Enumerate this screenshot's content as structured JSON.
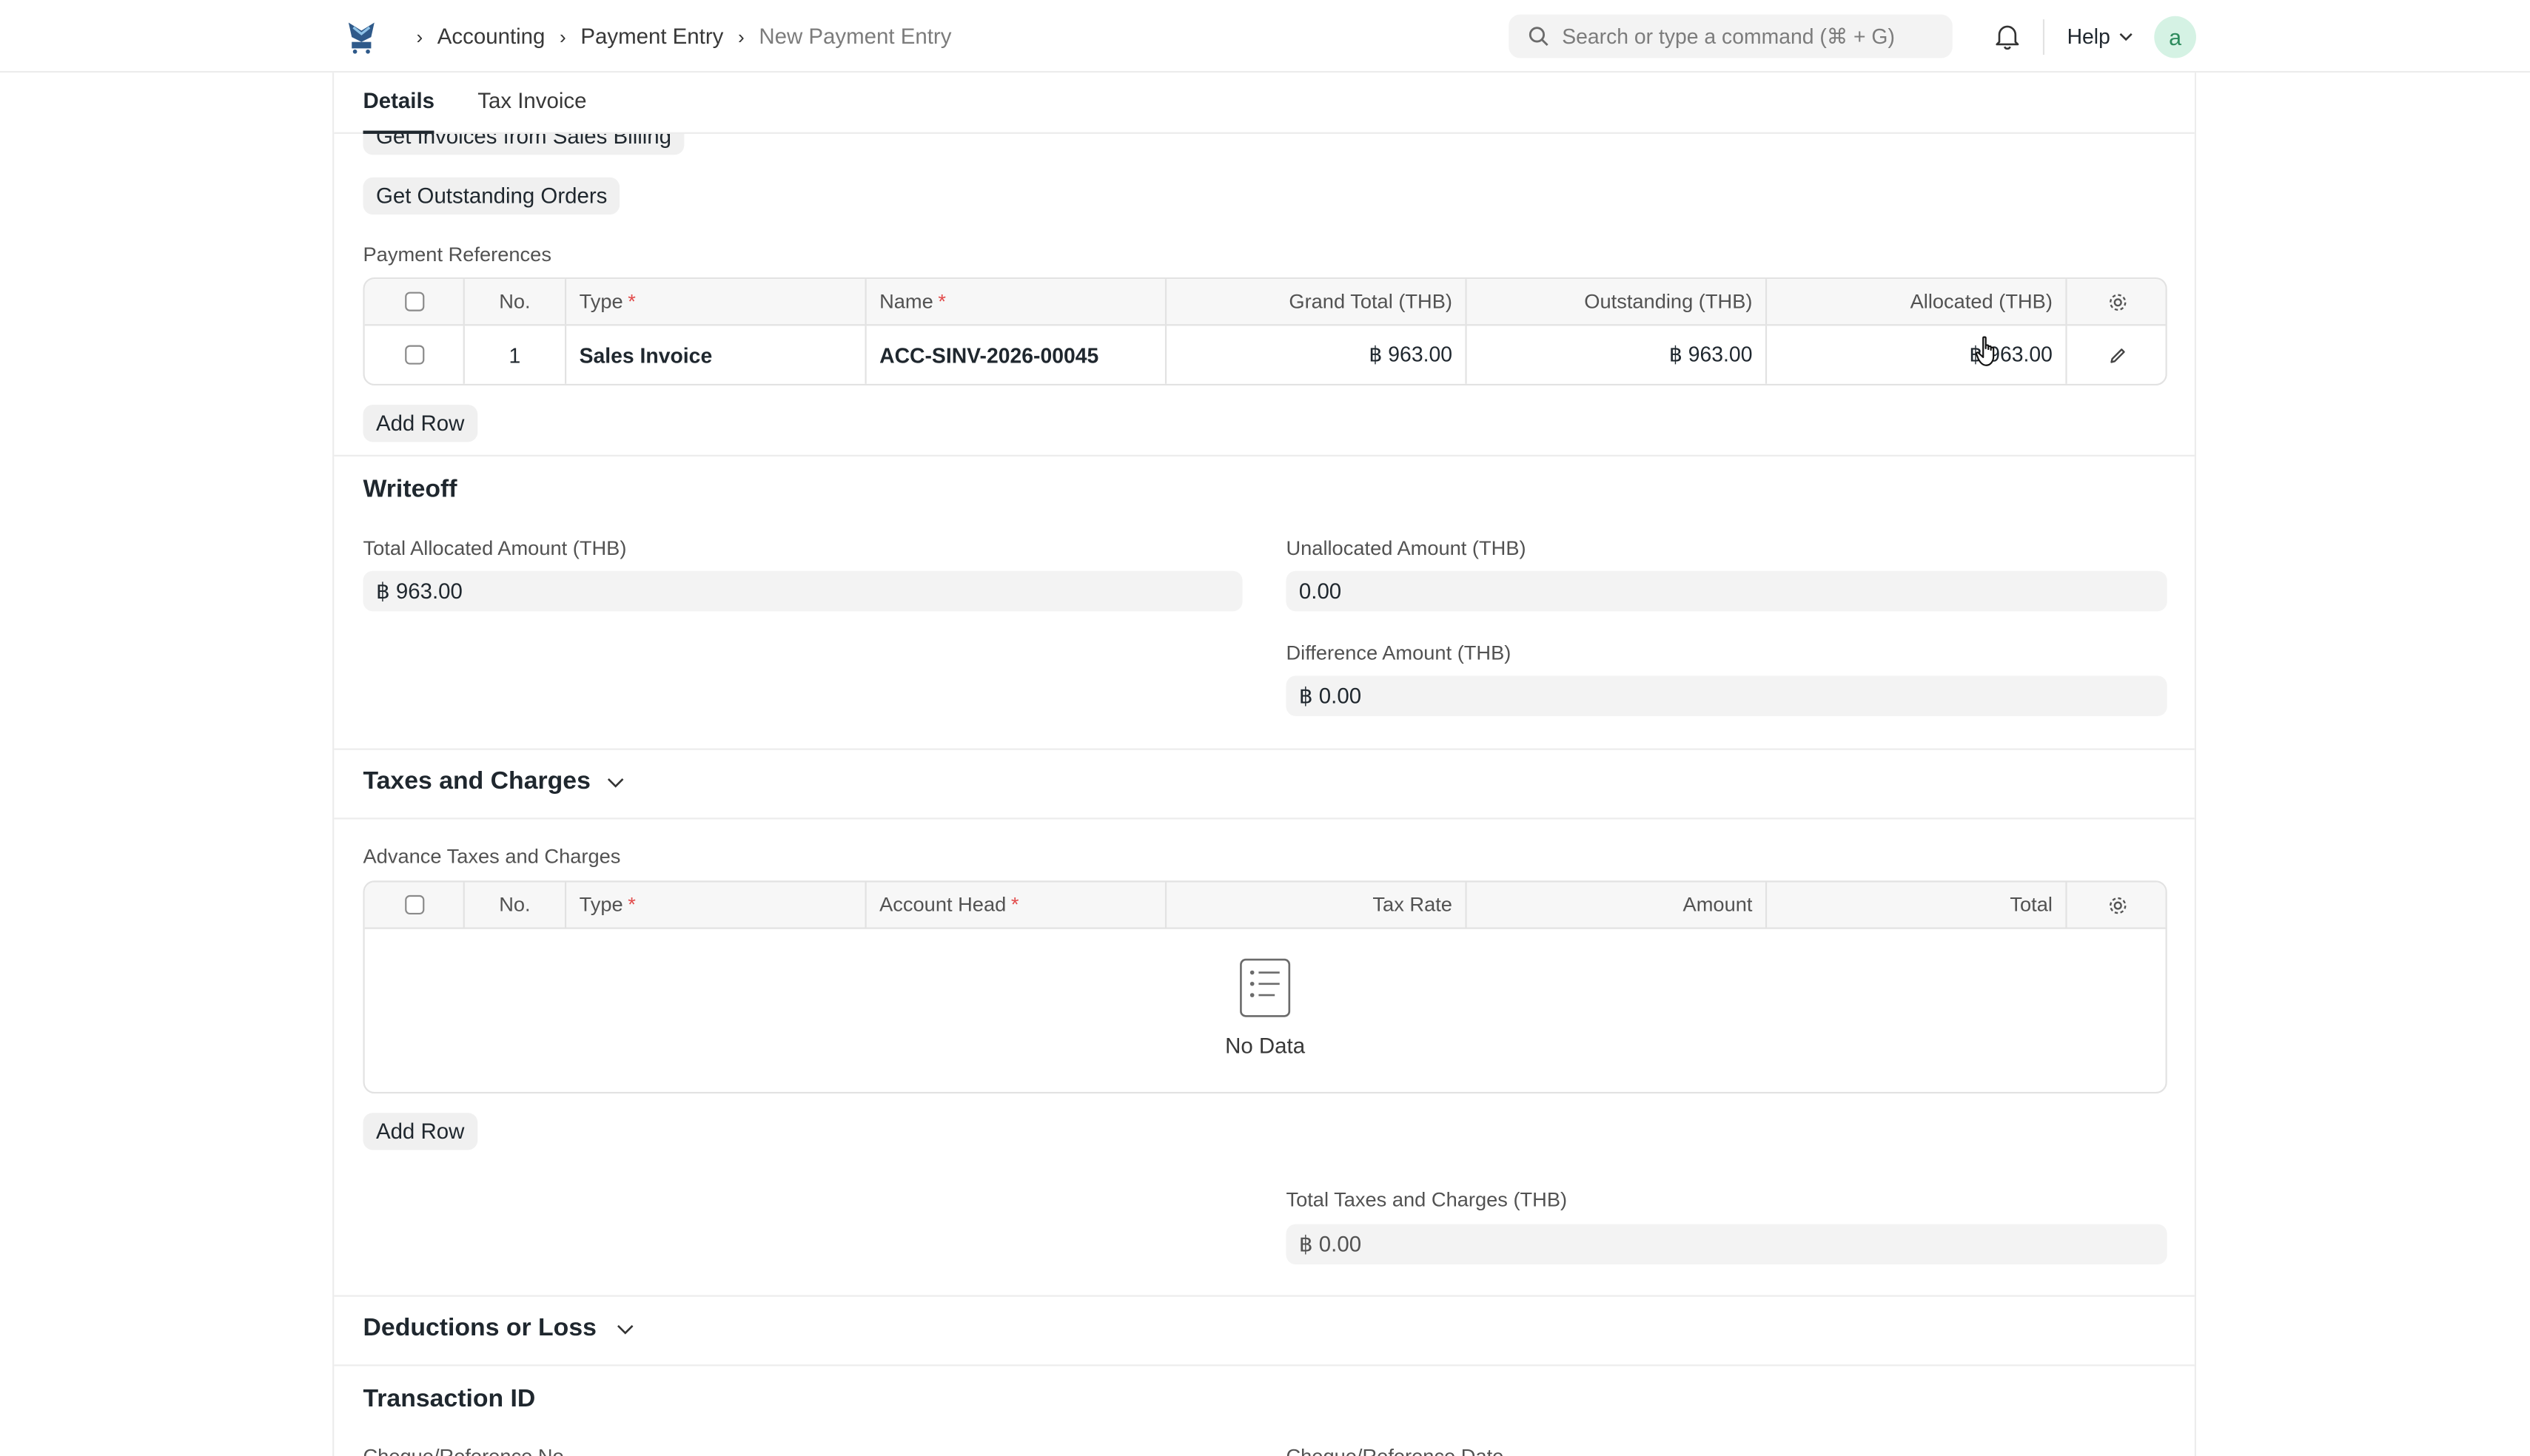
{
  "navbar": {
    "breadcrumbs": [
      "Accounting",
      "Payment Entry",
      "New Payment Entry"
    ],
    "search_placeholder": "Search or type a command (⌘ + G)",
    "help_label": "Help",
    "avatar_letter": "a"
  },
  "tabs": [
    "Details",
    "Tax Invoice"
  ],
  "buttons": {
    "get_invoices": "Get Invoices from Sales Billing",
    "get_outstanding": "Get Outstanding Orders",
    "add_row": "Add Row"
  },
  "payment_references": {
    "label": "Payment References",
    "columns": {
      "no": "No.",
      "type": "Type",
      "name": "Name",
      "grand_total": "Grand Total (THB)",
      "outstanding": "Outstanding (THB)",
      "allocated": "Allocated (THB)"
    },
    "rows": [
      {
        "no": "1",
        "type": "Sales Invoice",
        "name": "ACC-SINV-2026-00045",
        "grand_total": "฿ 963.00",
        "outstanding": "฿ 963.00",
        "allocated": "฿ 963.00"
      }
    ]
  },
  "writeoff": {
    "title": "Writeoff",
    "total_allocated_label": "Total Allocated Amount (THB)",
    "total_allocated_value": "฿ 963.00",
    "unallocated_label": "Unallocated Amount (THB)",
    "unallocated_value": "0.00",
    "difference_label": "Difference Amount (THB)",
    "difference_value": "฿ 0.00"
  },
  "taxes": {
    "title": "Taxes and Charges",
    "table_label": "Advance Taxes and Charges",
    "columns": {
      "no": "No.",
      "type": "Type",
      "account_head": "Account Head",
      "tax_rate": "Tax Rate",
      "amount": "Amount",
      "total": "Total"
    },
    "empty_text": "No Data",
    "total_label": "Total Taxes and Charges (THB)",
    "total_value": "฿ 0.00"
  },
  "deductions": {
    "title": "Deductions or Loss"
  },
  "transaction": {
    "title": "Transaction ID",
    "cheque_no_label": "Cheque/Reference No",
    "cheque_date_label": "Cheque/Reference Date"
  }
}
